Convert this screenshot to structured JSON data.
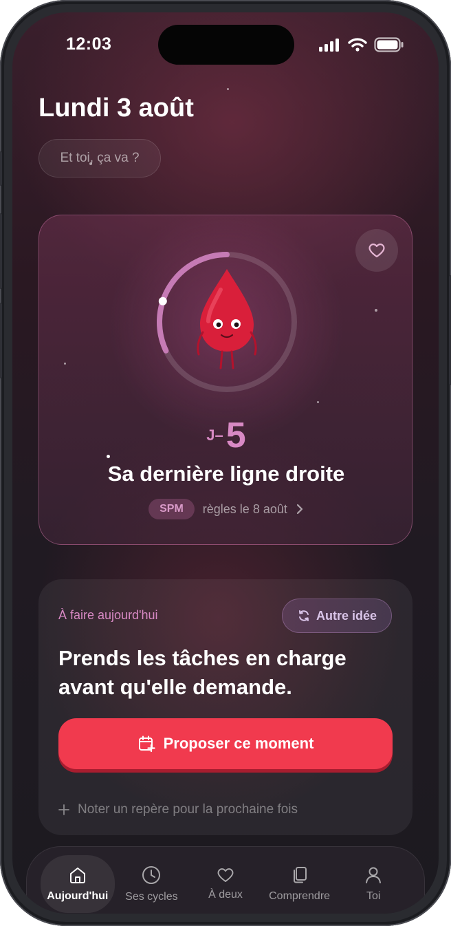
{
  "status": {
    "time": "12:03"
  },
  "header": {
    "date": "Lundi 3 août"
  },
  "mood": {
    "prompt": "Et toi, ça va ?"
  },
  "hero": {
    "cycle_progress": 0.32,
    "countdown_prefix": "J–",
    "countdown_value": "5",
    "title": "Sa dernière ligne droite",
    "phase_badge": "SPM",
    "next_period": "règles le 8 août",
    "accent_color": "#d889c4"
  },
  "task": {
    "label": "À faire aujourd'hui",
    "other_idea_label": "Autre idée",
    "text": "Prends les tâches en charge avant qu'elle demande.",
    "cta_label": "Proposer ce moment",
    "cta_color": "#f13a4e",
    "note_label": "Noter un repère pour la prochaine fois"
  },
  "tabs": [
    {
      "label": "Aujourd'hui",
      "icon": "home-icon",
      "active": true
    },
    {
      "label": "Ses cycles",
      "icon": "clock-icon",
      "active": false
    },
    {
      "label": "À deux",
      "icon": "heart-icon",
      "active": false
    },
    {
      "label": "Comprendre",
      "icon": "cards-icon",
      "active": false
    },
    {
      "label": "Toi",
      "icon": "user-icon",
      "active": false
    }
  ]
}
